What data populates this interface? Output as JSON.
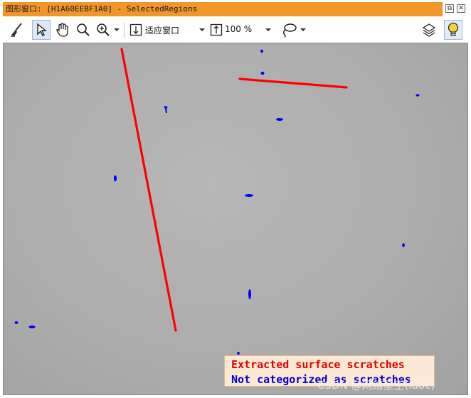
{
  "window": {
    "title": "图形窗口: [H1A60EEBF1A0] - SelectedRegions",
    "restore_glyph": "⧉",
    "close_glyph": "✕"
  },
  "toolbar": {
    "tools": [
      {
        "name": "clear-brush-icon"
      },
      {
        "name": "pointer-icon",
        "active": true
      },
      {
        "name": "pan-hand-icon"
      },
      {
        "name": "magnify-icon"
      },
      {
        "name": "zoom-in-icon"
      }
    ],
    "fit_mode": "适应窗口",
    "zoom_level": "100 %",
    "draw_mode_icon": "lasso-icon",
    "layers_icon": "layers-icon",
    "tip_icon": "lightbulb-icon"
  },
  "canvas": {
    "colors": {
      "scratch": "#ff0000",
      "other": "#0000ff"
    },
    "legend": {
      "line1": "Extracted surface scratches",
      "line2": "Not categorized as scratches"
    }
  },
  "watermark": "CSDN @网络星空(luoc)"
}
